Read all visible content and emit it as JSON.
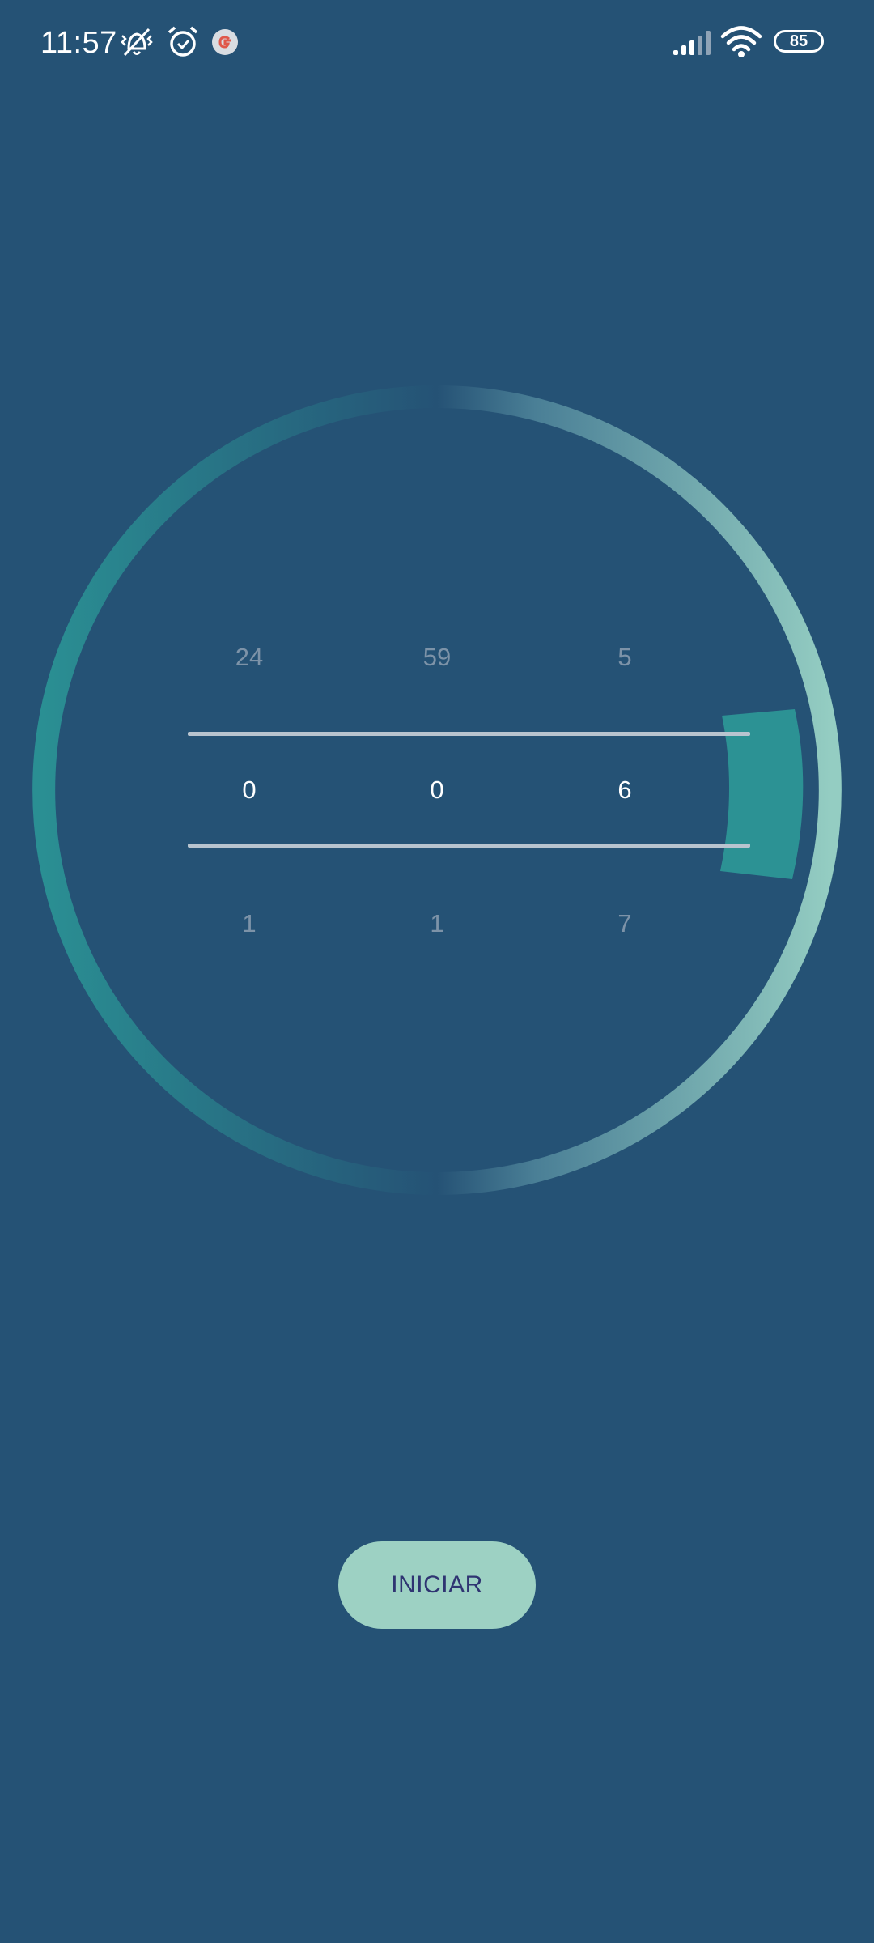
{
  "status_bar": {
    "time": "11:57",
    "battery": "85",
    "icons": [
      "vibrate-off-icon",
      "alarm-icon",
      "google-icon",
      "signal-icon",
      "wifi-icon",
      "battery-icon"
    ]
  },
  "colors": {
    "background": "#255275",
    "ring_start": "#2a8f93",
    "ring_end": "#8ecbc0",
    "handle": "#2c9294",
    "button_bg": "#9dd1c3",
    "button_text": "#2f3472"
  },
  "picker": {
    "hours": {
      "prev": "24",
      "selected": "0",
      "next": "1"
    },
    "minutes": {
      "prev": "59",
      "selected": "0",
      "next": "1"
    },
    "seconds": {
      "prev": "5",
      "selected": "6",
      "next": "7"
    }
  },
  "start_button": {
    "label": "INICIAR"
  }
}
